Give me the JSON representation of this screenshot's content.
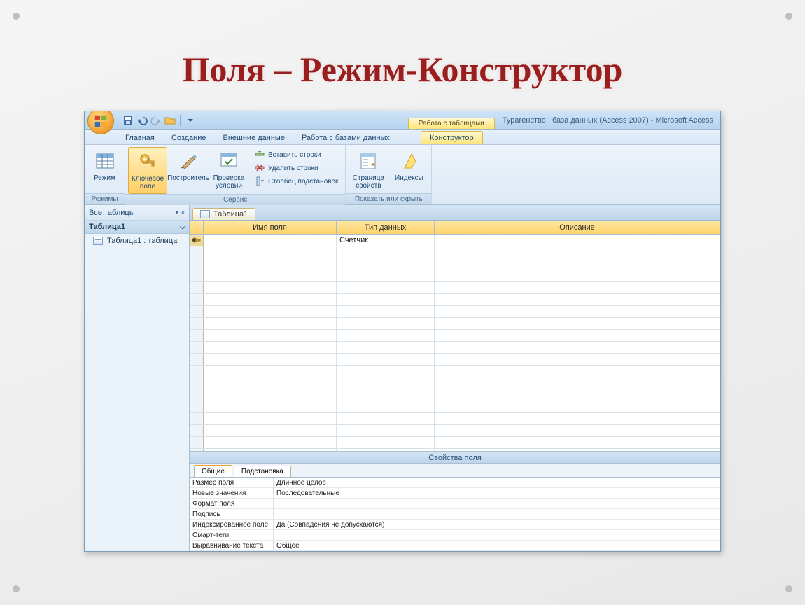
{
  "slide": {
    "title": "Поля – Режим-Конструктор"
  },
  "titlebar": {
    "context_group": "Работа с таблицами",
    "window_title": "Турагенство : база данных (Access 2007) - Microsoft Access"
  },
  "ribbon": {
    "tabs": [
      "Главная",
      "Создание",
      "Внешние данные",
      "Работа с базами данных"
    ],
    "context_tab": "Конструктор",
    "groups": {
      "modes": {
        "label": "Режимы",
        "mode_btn": "Режим"
      },
      "service": {
        "label": "Сервис",
        "key_btn": "Ключевое поле",
        "builder_btn": "Построитель",
        "test_btn": "Проверка условий",
        "insert_rows": "Вставить строки",
        "delete_rows": "Удалить строки",
        "lookup_col": "Столбец подстановок"
      },
      "show_hide": {
        "label": "Показать или скрыть",
        "propsheet_btn": "Страница свойств",
        "indexes_btn": "Индексы"
      }
    }
  },
  "nav": {
    "header": "Все таблицы",
    "group": "Таблица1",
    "item": "Таблица1 : таблица"
  },
  "doc_tab": "Таблица1",
  "grid": {
    "col_name": "Имя поля",
    "col_type": "Тип данных",
    "col_desc": "Описание",
    "row1_type": "Счетчик"
  },
  "props": {
    "title": "Свойства поля",
    "tab1": "Общие",
    "tab2": "Подстановка",
    "rows": [
      {
        "name": "Размер поля",
        "value": "Длинное целое"
      },
      {
        "name": "Новые значения",
        "value": "Последовательные"
      },
      {
        "name": "Формат поля",
        "value": ""
      },
      {
        "name": "Подпись",
        "value": ""
      },
      {
        "name": "Индексированное поле",
        "value": "Да (Совпадения не допускаются)"
      },
      {
        "name": "Смарт-теги",
        "value": ""
      },
      {
        "name": "Выравнивание текста",
        "value": "Общее"
      }
    ]
  }
}
